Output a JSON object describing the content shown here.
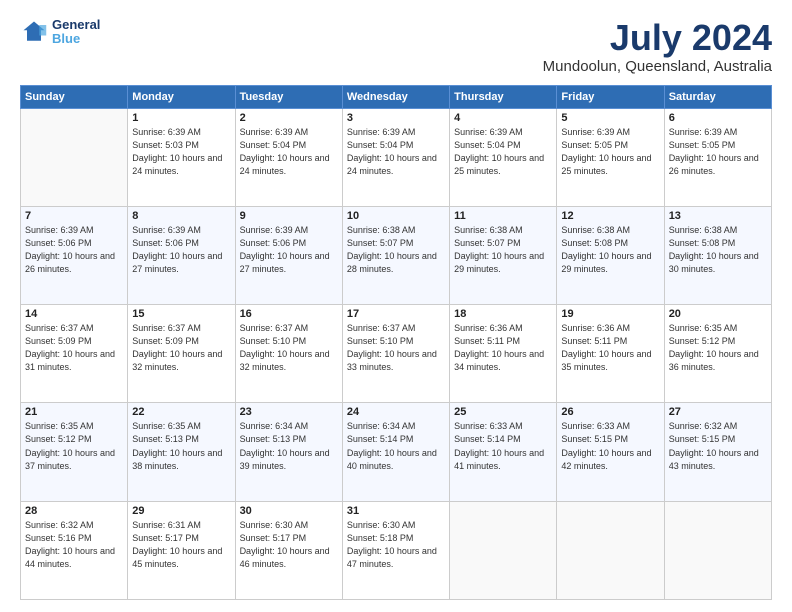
{
  "header": {
    "logo_line1": "General",
    "logo_line2": "Blue",
    "month_year": "July 2024",
    "location": "Mundoolun, Queensland, Australia"
  },
  "weekdays": [
    "Sunday",
    "Monday",
    "Tuesday",
    "Wednesday",
    "Thursday",
    "Friday",
    "Saturday"
  ],
  "weeks": [
    [
      {
        "day": "",
        "sunrise": "",
        "sunset": "",
        "daylight": ""
      },
      {
        "day": "1",
        "sunrise": "Sunrise: 6:39 AM",
        "sunset": "Sunset: 5:03 PM",
        "daylight": "Daylight: 10 hours and 24 minutes."
      },
      {
        "day": "2",
        "sunrise": "Sunrise: 6:39 AM",
        "sunset": "Sunset: 5:04 PM",
        "daylight": "Daylight: 10 hours and 24 minutes."
      },
      {
        "day": "3",
        "sunrise": "Sunrise: 6:39 AM",
        "sunset": "Sunset: 5:04 PM",
        "daylight": "Daylight: 10 hours and 24 minutes."
      },
      {
        "day": "4",
        "sunrise": "Sunrise: 6:39 AM",
        "sunset": "Sunset: 5:04 PM",
        "daylight": "Daylight: 10 hours and 25 minutes."
      },
      {
        "day": "5",
        "sunrise": "Sunrise: 6:39 AM",
        "sunset": "Sunset: 5:05 PM",
        "daylight": "Daylight: 10 hours and 25 minutes."
      },
      {
        "day": "6",
        "sunrise": "Sunrise: 6:39 AM",
        "sunset": "Sunset: 5:05 PM",
        "daylight": "Daylight: 10 hours and 26 minutes."
      }
    ],
    [
      {
        "day": "7",
        "sunrise": "Sunrise: 6:39 AM",
        "sunset": "Sunset: 5:06 PM",
        "daylight": "Daylight: 10 hours and 26 minutes."
      },
      {
        "day": "8",
        "sunrise": "Sunrise: 6:39 AM",
        "sunset": "Sunset: 5:06 PM",
        "daylight": "Daylight: 10 hours and 27 minutes."
      },
      {
        "day": "9",
        "sunrise": "Sunrise: 6:39 AM",
        "sunset": "Sunset: 5:06 PM",
        "daylight": "Daylight: 10 hours and 27 minutes."
      },
      {
        "day": "10",
        "sunrise": "Sunrise: 6:38 AM",
        "sunset": "Sunset: 5:07 PM",
        "daylight": "Daylight: 10 hours and 28 minutes."
      },
      {
        "day": "11",
        "sunrise": "Sunrise: 6:38 AM",
        "sunset": "Sunset: 5:07 PM",
        "daylight": "Daylight: 10 hours and 29 minutes."
      },
      {
        "day": "12",
        "sunrise": "Sunrise: 6:38 AM",
        "sunset": "Sunset: 5:08 PM",
        "daylight": "Daylight: 10 hours and 29 minutes."
      },
      {
        "day": "13",
        "sunrise": "Sunrise: 6:38 AM",
        "sunset": "Sunset: 5:08 PM",
        "daylight": "Daylight: 10 hours and 30 minutes."
      }
    ],
    [
      {
        "day": "14",
        "sunrise": "Sunrise: 6:37 AM",
        "sunset": "Sunset: 5:09 PM",
        "daylight": "Daylight: 10 hours and 31 minutes."
      },
      {
        "day": "15",
        "sunrise": "Sunrise: 6:37 AM",
        "sunset": "Sunset: 5:09 PM",
        "daylight": "Daylight: 10 hours and 32 minutes."
      },
      {
        "day": "16",
        "sunrise": "Sunrise: 6:37 AM",
        "sunset": "Sunset: 5:10 PM",
        "daylight": "Daylight: 10 hours and 32 minutes."
      },
      {
        "day": "17",
        "sunrise": "Sunrise: 6:37 AM",
        "sunset": "Sunset: 5:10 PM",
        "daylight": "Daylight: 10 hours and 33 minutes."
      },
      {
        "day": "18",
        "sunrise": "Sunrise: 6:36 AM",
        "sunset": "Sunset: 5:11 PM",
        "daylight": "Daylight: 10 hours and 34 minutes."
      },
      {
        "day": "19",
        "sunrise": "Sunrise: 6:36 AM",
        "sunset": "Sunset: 5:11 PM",
        "daylight": "Daylight: 10 hours and 35 minutes."
      },
      {
        "day": "20",
        "sunrise": "Sunrise: 6:35 AM",
        "sunset": "Sunset: 5:12 PM",
        "daylight": "Daylight: 10 hours and 36 minutes."
      }
    ],
    [
      {
        "day": "21",
        "sunrise": "Sunrise: 6:35 AM",
        "sunset": "Sunset: 5:12 PM",
        "daylight": "Daylight: 10 hours and 37 minutes."
      },
      {
        "day": "22",
        "sunrise": "Sunrise: 6:35 AM",
        "sunset": "Sunset: 5:13 PM",
        "daylight": "Daylight: 10 hours and 38 minutes."
      },
      {
        "day": "23",
        "sunrise": "Sunrise: 6:34 AM",
        "sunset": "Sunset: 5:13 PM",
        "daylight": "Daylight: 10 hours and 39 minutes."
      },
      {
        "day": "24",
        "sunrise": "Sunrise: 6:34 AM",
        "sunset": "Sunset: 5:14 PM",
        "daylight": "Daylight: 10 hours and 40 minutes."
      },
      {
        "day": "25",
        "sunrise": "Sunrise: 6:33 AM",
        "sunset": "Sunset: 5:14 PM",
        "daylight": "Daylight: 10 hours and 41 minutes."
      },
      {
        "day": "26",
        "sunrise": "Sunrise: 6:33 AM",
        "sunset": "Sunset: 5:15 PM",
        "daylight": "Daylight: 10 hours and 42 minutes."
      },
      {
        "day": "27",
        "sunrise": "Sunrise: 6:32 AM",
        "sunset": "Sunset: 5:15 PM",
        "daylight": "Daylight: 10 hours and 43 minutes."
      }
    ],
    [
      {
        "day": "28",
        "sunrise": "Sunrise: 6:32 AM",
        "sunset": "Sunset: 5:16 PM",
        "daylight": "Daylight: 10 hours and 44 minutes."
      },
      {
        "day": "29",
        "sunrise": "Sunrise: 6:31 AM",
        "sunset": "Sunset: 5:17 PM",
        "daylight": "Daylight: 10 hours and 45 minutes."
      },
      {
        "day": "30",
        "sunrise": "Sunrise: 6:30 AM",
        "sunset": "Sunset: 5:17 PM",
        "daylight": "Daylight: 10 hours and 46 minutes."
      },
      {
        "day": "31",
        "sunrise": "Sunrise: 6:30 AM",
        "sunset": "Sunset: 5:18 PM",
        "daylight": "Daylight: 10 hours and 47 minutes."
      },
      {
        "day": "",
        "sunrise": "",
        "sunset": "",
        "daylight": ""
      },
      {
        "day": "",
        "sunrise": "",
        "sunset": "",
        "daylight": ""
      },
      {
        "day": "",
        "sunrise": "",
        "sunset": "",
        "daylight": ""
      }
    ]
  ]
}
